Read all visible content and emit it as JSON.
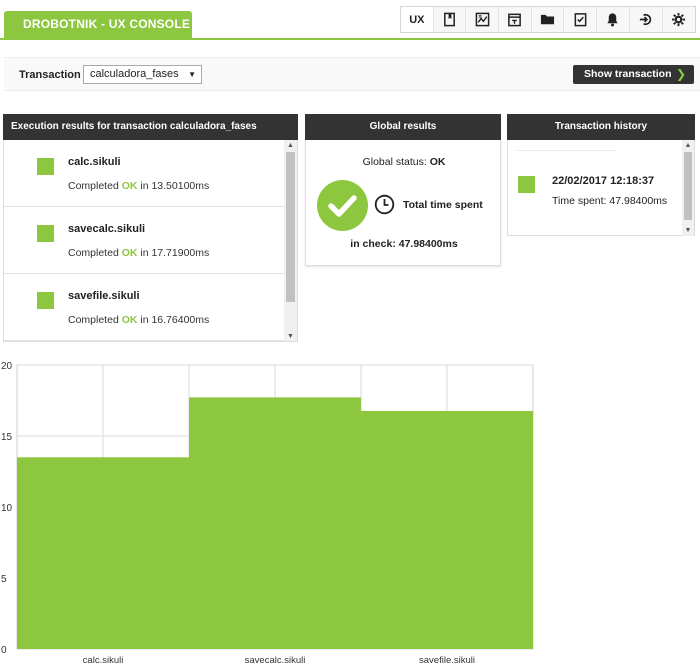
{
  "app": {
    "title": "DROBOTNIK - UX CONSOLE"
  },
  "toolbar": {
    "items": [
      {
        "label": "UX",
        "icon": "ux-label",
        "active": true
      },
      {
        "label": "",
        "icon": "bookmark-icon"
      },
      {
        "label": "",
        "icon": "chart-icon"
      },
      {
        "label": "",
        "icon": "calendar-icon"
      },
      {
        "label": "",
        "icon": "folder-icon"
      },
      {
        "label": "",
        "icon": "checklist-icon"
      },
      {
        "label": "",
        "icon": "bell-icon"
      },
      {
        "label": "",
        "icon": "logout-icon"
      },
      {
        "label": "",
        "icon": "gear-icon"
      }
    ]
  },
  "transaction": {
    "label": "Transaction",
    "selected": "calculadora_fases",
    "show_button": "Show transaction"
  },
  "execution": {
    "title": "Execution results for transaction calculadora_fases",
    "items": [
      {
        "name": "calc.sikuli",
        "prefix": "Completed",
        "status": "OK",
        "suffix": "in 13.50100ms"
      },
      {
        "name": "savecalc.sikuli",
        "prefix": "Completed",
        "status": "OK",
        "suffix": "in 17.71900ms"
      },
      {
        "name": "savefile.sikuli",
        "prefix": "Completed",
        "status": "OK",
        "suffix": "in 16.76400ms"
      }
    ]
  },
  "global": {
    "title": "Global results",
    "status_label": "Global status:",
    "status_value": "OK",
    "total_label": "Total time spent",
    "in_check_label": "in check: 47.98400ms"
  },
  "history": {
    "title": "Transaction history",
    "items": [
      {
        "date": "22/02/2017 12:18:37",
        "time_spent": "Time spent: 47.98400ms"
      }
    ]
  },
  "colors": {
    "accent": "#8dc63f",
    "dark": "#333333"
  },
  "chart_data": {
    "type": "bar",
    "categories": [
      "calc.sikuli",
      "savecalc.sikuli",
      "savefile.sikuli"
    ],
    "values": [
      13.501,
      17.719,
      16.764
    ],
    "ylim": [
      0,
      20
    ],
    "yticks": [
      0,
      5,
      10,
      15,
      20
    ],
    "title": "",
    "xlabel": "",
    "ylabel": "",
    "grid": true,
    "color": "#8dc63f"
  }
}
